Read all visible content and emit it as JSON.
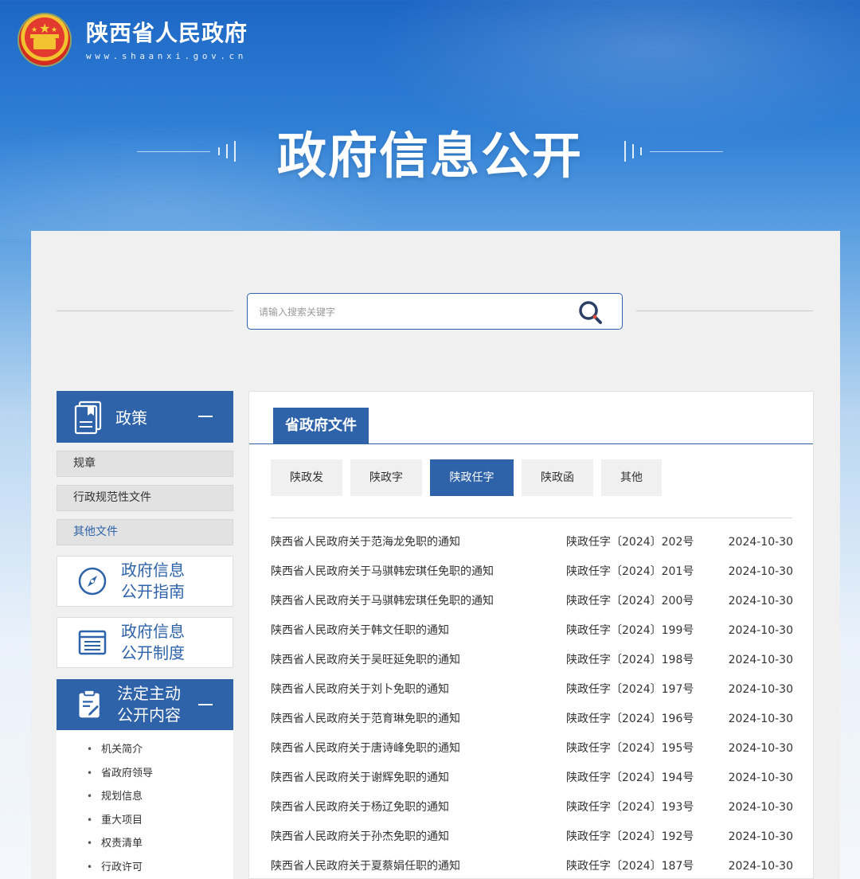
{
  "header": {
    "site_title": "陕西省人民政府",
    "site_url": "www.shaanxi.gov.cn"
  },
  "banner": {
    "title": "政府信息公开"
  },
  "search": {
    "placeholder": "请输入搜索关键字",
    "icon": "search-icon"
  },
  "sidebar": {
    "policy": {
      "label": "政策",
      "icon": "document-icon"
    },
    "policy_items": [
      {
        "label": "规章"
      },
      {
        "label": "行政规范性文件"
      },
      {
        "label": "其他文件"
      }
    ],
    "guide": {
      "line1": "政府信息",
      "line2": "公开指南",
      "icon": "compass-icon"
    },
    "system": {
      "line1": "政府信息",
      "line2": "公开制度",
      "icon": "list-icon"
    },
    "statutory": {
      "line1": "法定主动",
      "line2": "公开内容",
      "icon": "clipboard-icon"
    },
    "statutory_items": [
      "机关简介",
      "省政府领导",
      "规划信息",
      "重大项目",
      "权责清单",
      "行政许可"
    ]
  },
  "content": {
    "main_tab": "省政府文件",
    "sub_tabs": [
      "陕政发",
      "陕政字",
      "陕政任字",
      "陕政函",
      "其他"
    ],
    "active_sub_tab": "陕政任字",
    "documents": [
      {
        "title": "陕西省人民政府关于范海龙免职的通知",
        "number": "陕政任字〔2024〕202号",
        "date": "2024-10-30"
      },
      {
        "title": "陕西省人民政府关于马骐韩宏琪任免职的通知",
        "number": "陕政任字〔2024〕201号",
        "date": "2024-10-30"
      },
      {
        "title": "陕西省人民政府关于马骐韩宏琪任免职的通知",
        "number": "陕政任字〔2024〕200号",
        "date": "2024-10-30"
      },
      {
        "title": "陕西省人民政府关于韩文任职的通知",
        "number": "陕政任字〔2024〕199号",
        "date": "2024-10-30"
      },
      {
        "title": "陕西省人民政府关于吴旺延免职的通知",
        "number": "陕政任字〔2024〕198号",
        "date": "2024-10-30"
      },
      {
        "title": "陕西省人民政府关于刘卜免职的通知",
        "number": "陕政任字〔2024〕197号",
        "date": "2024-10-30"
      },
      {
        "title": "陕西省人民政府关于范育琳免职的通知",
        "number": "陕政任字〔2024〕196号",
        "date": "2024-10-30"
      },
      {
        "title": "陕西省人民政府关于唐诗峰免职的通知",
        "number": "陕政任字〔2024〕195号",
        "date": "2024-10-30"
      },
      {
        "title": "陕西省人民政府关于谢辉免职的通知",
        "number": "陕政任字〔2024〕194号",
        "date": "2024-10-30"
      },
      {
        "title": "陕西省人民政府关于杨辽免职的通知",
        "number": "陕政任字〔2024〕193号",
        "date": "2024-10-30"
      },
      {
        "title": "陕西省人民政府关于孙杰免职的通知",
        "number": "陕政任字〔2024〕192号",
        "date": "2024-10-30"
      },
      {
        "title": "陕西省人民政府关于夏蔡娟任职的通知",
        "number": "陕政任字〔2024〕187号",
        "date": "2024-10-30"
      }
    ]
  },
  "colors": {
    "brand_blue": "#2e63a9",
    "panel_bg": "#f0f0f0"
  }
}
